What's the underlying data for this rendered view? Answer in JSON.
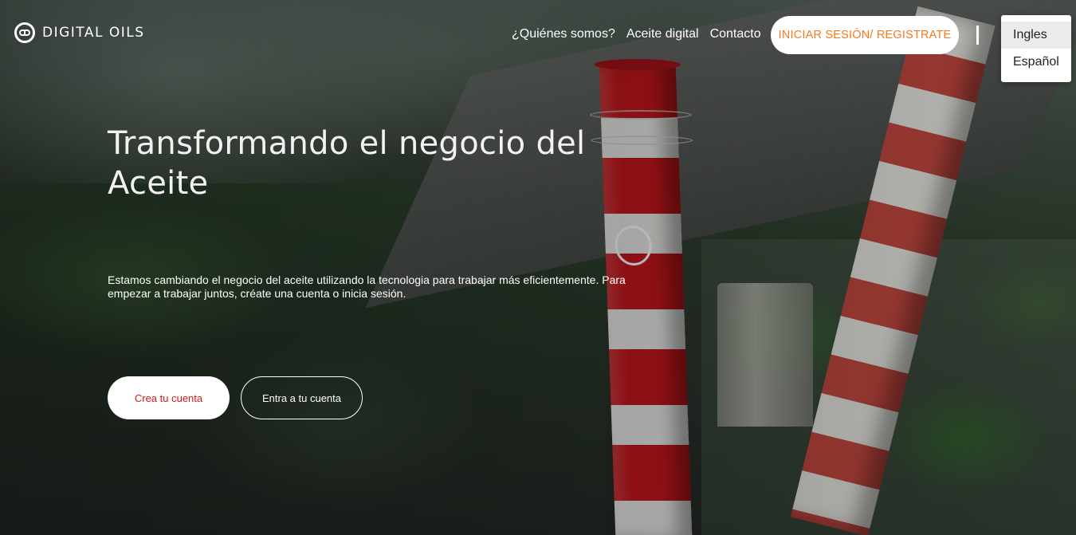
{
  "brand": {
    "name": "DIGITAL OILS"
  },
  "nav": {
    "items": [
      {
        "label": "¿Quiénes somos?"
      },
      {
        "label": "Aceite digital"
      },
      {
        "label": "Contacto"
      }
    ],
    "login_label": "INICIAR SESIÓN/ REGISTRATE",
    "language": {
      "options": [
        "Ingles",
        "Español"
      ],
      "selected": "Ingles"
    }
  },
  "hero": {
    "title": "Transformando el negocio del Aceite",
    "description": "Estamos cambiando el negocio del aceite utilizando la tecnologia para trabajar más eficientemente. Para empezar a trabajar juntos, créate una cuenta o inicia sesión.",
    "primary_button": "Crea tu cuenta",
    "secondary_button": "Entra a tu cuenta"
  },
  "colors": {
    "accent_orange": "#f47a20",
    "accent_red": "#d11a1a",
    "white": "#ffffff"
  }
}
